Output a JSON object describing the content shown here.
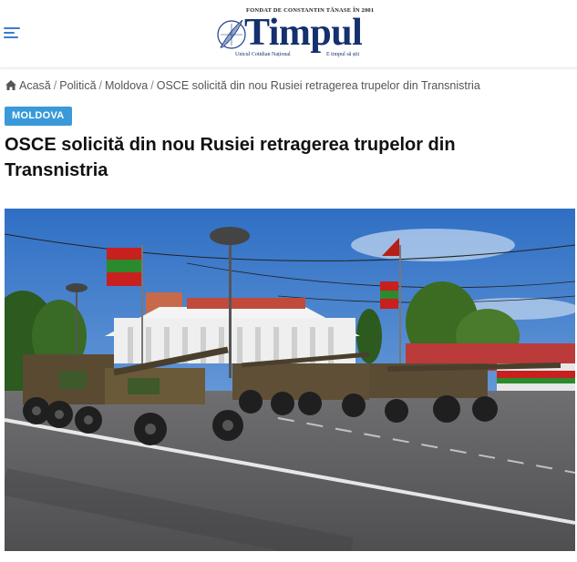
{
  "header": {
    "menu_icon": "hamburger-menu-icon",
    "logo": {
      "tagline": "FONDAT DE CONSTANTIN TĂNASE ÎN 2001",
      "wordmark": "Timpul",
      "subtitle_left": "Unicul Cotidian Național",
      "subtitle_right": "E timpul să știi",
      "brand_color": "#14306e"
    }
  },
  "breadcrumb": {
    "home_icon": "home-icon",
    "items": [
      "Acasă",
      "Politică",
      "Moldova",
      "OSCE solicită din nou Rusiei retragerea trupelor din Transnistria"
    ],
    "separator": "/"
  },
  "article": {
    "category": "MOLDOVA",
    "category_color": "#3a9ad9",
    "title": "OSCE solicită din nou Rusiei retragerea trupelor din Transnistria",
    "image_alt": "Military parade with artillery pieces in Tiraspol"
  }
}
